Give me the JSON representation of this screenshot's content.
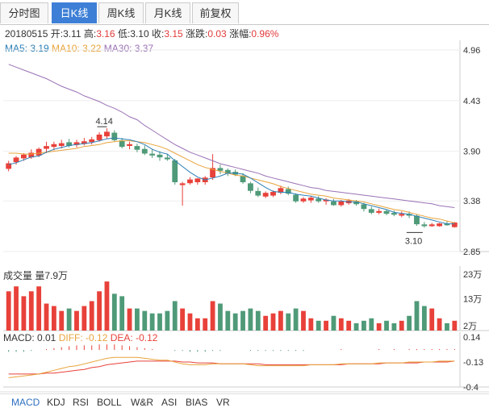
{
  "tabs": [
    "分时图",
    "日K线",
    "周K线",
    "月K线",
    "前复权"
  ],
  "active_tab": 1,
  "info": {
    "date": "20180515",
    "open_label": "开:",
    "open": "3.11",
    "high_label": "高:",
    "high": "3.16",
    "low_label": "低:",
    "low": "3.10",
    "close_label": "收:",
    "close": "3.15",
    "change_label": "涨跌:",
    "change": "0.03",
    "pct_label": "涨幅:",
    "pct": "0.96%"
  },
  "ma_legend": {
    "ma5": "MA5: 3.19",
    "ma10": "MA10: 3.22",
    "ma30": "MA30: 3.37",
    "colors": {
      "ma5": "#2d7fb5",
      "ma10": "#e8a33b",
      "ma30": "#9a72b5"
    }
  },
  "volume_label": "成交量 量7.9万",
  "macd_legend": {
    "macd": "MACD: 0.01",
    "diff": "DIFF: -0.12",
    "dea": "DEA: -0.12"
  },
  "bottom_tabs": [
    "MACD",
    "KDJ",
    "RSI",
    "BOLL",
    "W&R",
    "ASI",
    "BIAS",
    "VR"
  ],
  "chart_data": {
    "type": "candlestick",
    "price_axis": {
      "ticks": [
        "4.96",
        "4.43",
        "3.90",
        "3.38",
        "2.85"
      ],
      "ylim": [
        2.85,
        4.96
      ]
    },
    "volume_axis": {
      "ticks": [
        "23万",
        "13万",
        "2万"
      ],
      "ylim": [
        0,
        23
      ]
    },
    "macd_axis": {
      "ticks": [
        "0.14",
        "-0.13",
        "-0.4"
      ],
      "ylim": [
        -0.4,
        0.14
      ]
    },
    "annotations": [
      {
        "text": "4.14",
        "value": 4.14,
        "bar": 13
      },
      {
        "text": "3.10",
        "value": 3.1,
        "bar": 55
      }
    ],
    "colors": {
      "up": "#e8413a",
      "down": "#4f9a78"
    },
    "candles": [
      [
        3.72,
        3.8,
        3.69,
        3.77
      ],
      [
        3.79,
        3.85,
        3.76,
        3.83
      ],
      [
        3.83,
        3.88,
        3.8,
        3.86
      ],
      [
        3.84,
        3.92,
        3.82,
        3.88
      ],
      [
        3.86,
        3.94,
        3.84,
        3.92
      ],
      [
        3.93,
        4.0,
        3.88,
        3.95
      ],
      [
        3.95,
        4.0,
        3.91,
        3.97
      ],
      [
        3.96,
        4.02,
        3.93,
        3.98
      ],
      [
        3.99,
        4.03,
        3.94,
        3.96
      ],
      [
        3.97,
        4.02,
        3.94,
        3.99
      ],
      [
        3.98,
        4.04,
        3.96,
        4.0
      ],
      [
        4.0,
        4.05,
        3.97,
        4.02
      ],
      [
        4.02,
        4.1,
        4.0,
        4.07
      ],
      [
        4.06,
        4.14,
        4.03,
        4.1
      ],
      [
        4.09,
        4.12,
        4.0,
        4.02
      ],
      [
        4.01,
        4.04,
        3.93,
        3.95
      ],
      [
        3.96,
        4.0,
        3.92,
        3.97
      ],
      [
        3.95,
        3.98,
        3.89,
        3.92
      ],
      [
        3.92,
        3.96,
        3.86,
        3.88
      ],
      [
        3.87,
        3.92,
        3.83,
        3.86
      ],
      [
        3.86,
        3.9,
        3.8,
        3.84
      ],
      [
        3.83,
        3.87,
        3.8,
        3.82
      ],
      [
        3.8,
        3.82,
        3.55,
        3.58
      ],
      [
        3.55,
        3.58,
        3.33,
        3.56
      ],
      [
        3.57,
        3.63,
        3.55,
        3.6
      ],
      [
        3.58,
        3.62,
        3.55,
        3.61
      ],
      [
        3.58,
        3.64,
        3.55,
        3.62
      ],
      [
        3.63,
        3.87,
        3.6,
        3.72
      ],
      [
        3.72,
        3.76,
        3.66,
        3.7
      ],
      [
        3.7,
        3.72,
        3.64,
        3.67
      ],
      [
        3.68,
        3.71,
        3.64,
        3.66
      ],
      [
        3.64,
        3.67,
        3.56,
        3.58
      ],
      [
        3.56,
        3.58,
        3.46,
        3.49
      ],
      [
        3.48,
        3.52,
        3.42,
        3.44
      ],
      [
        3.43,
        3.48,
        3.41,
        3.46
      ],
      [
        3.44,
        3.49,
        3.42,
        3.47
      ],
      [
        3.47,
        3.54,
        3.45,
        3.51
      ],
      [
        3.5,
        3.53,
        3.44,
        3.46
      ],
      [
        3.44,
        3.46,
        3.36,
        3.38
      ],
      [
        3.38,
        3.42,
        3.36,
        3.4
      ],
      [
        3.39,
        3.43,
        3.36,
        3.41
      ],
      [
        3.4,
        3.43,
        3.36,
        3.38
      ],
      [
        3.38,
        3.41,
        3.34,
        3.39
      ],
      [
        3.37,
        3.4,
        3.33,
        3.34
      ],
      [
        3.34,
        3.39,
        3.32,
        3.37
      ],
      [
        3.36,
        3.4,
        3.34,
        3.38
      ],
      [
        3.37,
        3.39,
        3.33,
        3.35
      ],
      [
        3.34,
        3.36,
        3.27,
        3.3
      ],
      [
        3.29,
        3.32,
        3.24,
        3.26
      ],
      [
        3.26,
        3.3,
        3.24,
        3.27
      ],
      [
        3.27,
        3.29,
        3.23,
        3.25
      ],
      [
        3.25,
        3.28,
        3.22,
        3.24
      ],
      [
        3.23,
        3.27,
        3.21,
        3.24
      ],
      [
        3.24,
        3.27,
        3.2,
        3.23
      ],
      [
        3.22,
        3.24,
        3.12,
        3.14
      ],
      [
        3.13,
        3.16,
        3.1,
        3.12
      ],
      [
        3.12,
        3.15,
        3.11,
        3.13
      ],
      [
        3.12,
        3.15,
        3.11,
        3.14
      ],
      [
        3.14,
        3.17,
        3.12,
        3.13
      ],
      [
        3.11,
        3.16,
        3.1,
        3.15
      ]
    ],
    "ma5": [
      3.76,
      3.78,
      3.81,
      3.84,
      3.85,
      3.89,
      3.92,
      3.94,
      3.96,
      3.97,
      3.98,
      3.99,
      4.01,
      4.03,
      4.04,
      4.03,
      4.02,
      4.0,
      3.97,
      3.92,
      3.89,
      3.87,
      3.8,
      3.74,
      3.68,
      3.63,
      3.6,
      3.62,
      3.64,
      3.67,
      3.67,
      3.66,
      3.62,
      3.57,
      3.52,
      3.48,
      3.47,
      3.47,
      3.45,
      3.44,
      3.43,
      3.41,
      3.39,
      3.38,
      3.38,
      3.37,
      3.37,
      3.35,
      3.33,
      3.31,
      3.29,
      3.26,
      3.25,
      3.24,
      3.22,
      3.2,
      3.18,
      3.16,
      3.14,
      3.14
    ],
    "ma10": [
      3.88,
      3.88,
      3.87,
      3.87,
      3.88,
      3.89,
      3.9,
      3.91,
      3.92,
      3.93,
      3.95,
      3.96,
      3.97,
      3.99,
      4.0,
      4.01,
      4.01,
      4.0,
      3.99,
      3.97,
      3.95,
      3.92,
      3.88,
      3.84,
      3.8,
      3.76,
      3.73,
      3.71,
      3.69,
      3.67,
      3.65,
      3.64,
      3.62,
      3.6,
      3.58,
      3.56,
      3.53,
      3.51,
      3.49,
      3.47,
      3.45,
      3.44,
      3.43,
      3.41,
      3.4,
      3.39,
      3.38,
      3.37,
      3.35,
      3.33,
      3.31,
      3.29,
      3.28,
      3.26,
      3.24,
      3.22,
      3.2,
      3.19,
      3.17,
      3.15
    ],
    "ma30": [
      4.81,
      4.78,
      4.75,
      4.72,
      4.69,
      4.66,
      4.62,
      4.58,
      4.55,
      4.52,
      4.48,
      4.45,
      4.42,
      4.38,
      4.35,
      4.31,
      4.26,
      4.23,
      4.17,
      4.12,
      4.07,
      4.02,
      3.97,
      3.93,
      3.89,
      3.86,
      3.83,
      3.8,
      3.77,
      3.75,
      3.73,
      3.71,
      3.69,
      3.67,
      3.64,
      3.62,
      3.6,
      3.58,
      3.56,
      3.54,
      3.52,
      3.51,
      3.49,
      3.48,
      3.47,
      3.46,
      3.45,
      3.44,
      3.43,
      3.42,
      3.41,
      3.4,
      3.39,
      3.38,
      3.37,
      3.36,
      3.35,
      3.33,
      3.32,
      3.31
    ],
    "volume": [
      16,
      18,
      14,
      16,
      18,
      11,
      10,
      8,
      9,
      8,
      10,
      12,
      16,
      20,
      15,
      14,
      9,
      9,
      8,
      7,
      7,
      8,
      12,
      9,
      7,
      5,
      5,
      12,
      11,
      8,
      7,
      8,
      9,
      8,
      6,
      7,
      8,
      7,
      9,
      8,
      5,
      4,
      4,
      6,
      5,
      4,
      3,
      4,
      5,
      3,
      4,
      3,
      4,
      6,
      12,
      10,
      9,
      5,
      3,
      4
    ],
    "macd": {
      "diff": [
        -0.3,
        -0.29,
        -0.28,
        -0.27,
        -0.26,
        -0.24,
        -0.22,
        -0.2,
        -0.18,
        -0.17,
        -0.15,
        -0.13,
        -0.11,
        -0.09,
        -0.08,
        -0.08,
        -0.08,
        -0.08,
        -0.09,
        -0.1,
        -0.11,
        -0.11,
        -0.13,
        -0.15,
        -0.16,
        -0.16,
        -0.16,
        -0.15,
        -0.15,
        -0.15,
        -0.15,
        -0.15,
        -0.16,
        -0.17,
        -0.17,
        -0.17,
        -0.17,
        -0.17,
        -0.17,
        -0.17,
        -0.16,
        -0.16,
        -0.16,
        -0.16,
        -0.15,
        -0.15,
        -0.15,
        -0.15,
        -0.15,
        -0.14,
        -0.14,
        -0.14,
        -0.14,
        -0.13,
        -0.13,
        -0.13,
        -0.13,
        -0.12,
        -0.12,
        -0.12
      ],
      "dea": [
        -0.26,
        -0.26,
        -0.26,
        -0.26,
        -0.26,
        -0.25,
        -0.25,
        -0.24,
        -0.23,
        -0.22,
        -0.21,
        -0.19,
        -0.18,
        -0.16,
        -0.15,
        -0.14,
        -0.13,
        -0.12,
        -0.12,
        -0.12,
        -0.12,
        -0.12,
        -0.12,
        -0.13,
        -0.13,
        -0.14,
        -0.14,
        -0.14,
        -0.15,
        -0.15,
        -0.15,
        -0.15,
        -0.15,
        -0.15,
        -0.16,
        -0.16,
        -0.16,
        -0.16,
        -0.16,
        -0.16,
        -0.16,
        -0.16,
        -0.16,
        -0.16,
        -0.16,
        -0.15,
        -0.15,
        -0.15,
        -0.15,
        -0.15,
        -0.14,
        -0.14,
        -0.14,
        -0.14,
        -0.14,
        -0.13,
        -0.13,
        -0.13,
        -0.13,
        -0.12
      ],
      "hist": [
        -0.02,
        -0.02,
        -0.02,
        -0.01,
        0.0,
        0.01,
        0.02,
        0.03,
        0.04,
        0.05,
        0.05,
        0.05,
        0.06,
        0.06,
        0.06,
        0.05,
        0.04,
        0.03,
        0.02,
        0.01,
        0.0,
        0.0,
        -0.01,
        -0.01,
        -0.02,
        -0.02,
        -0.02,
        -0.01,
        -0.01,
        0.0,
        0.0,
        0.0,
        -0.01,
        -0.01,
        -0.01,
        -0.01,
        -0.01,
        -0.01,
        -0.01,
        -0.01,
        0.0,
        0.0,
        0.0,
        0.0,
        0.01,
        0.0,
        0.0,
        0.0,
        0.0,
        0.01,
        0.0,
        0.01,
        0.0,
        0.01,
        0.01,
        0.01,
        0.01,
        0.01,
        0.01,
        0.01
      ]
    }
  }
}
